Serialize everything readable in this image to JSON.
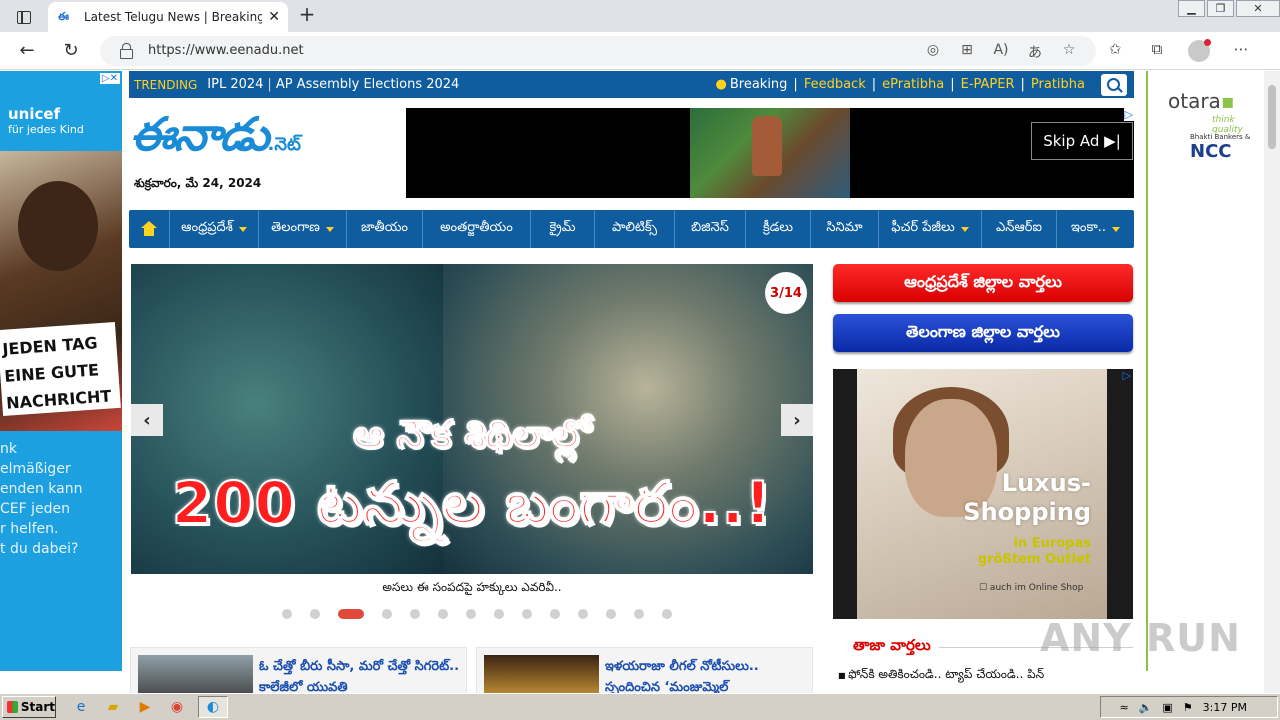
{
  "browser": {
    "tab_title": "Latest Telugu News | Breaking Ne",
    "tab_close": "✕",
    "new_tab": "+",
    "url": "https://www.eenadu.net",
    "back": "←",
    "reload": "↻"
  },
  "topstrip": {
    "trending_label": "TRENDING",
    "trending_items": [
      "IPL 2024",
      "AP Assembly Elections 2024"
    ],
    "breaking": "Breaking",
    "links": [
      "Feedback",
      "ePratibha",
      "E-PAPER",
      "Pratibha"
    ]
  },
  "masthead": {
    "logo_main": "ఈనాడు",
    "logo_suffix": ".నెట్",
    "date": "శుక్రవారం, మే 24, 2024"
  },
  "top_ad": {
    "skip_label": "Skip Ad ▶|"
  },
  "nav": {
    "items": [
      {
        "label": "ఆంధ్రప్రదేశ్",
        "dropdown": true
      },
      {
        "label": "తెలంగాణ",
        "dropdown": true
      },
      {
        "label": "జాతీయం",
        "dropdown": false
      },
      {
        "label": "అంతర్జాతీయం",
        "dropdown": false
      },
      {
        "label": "క్రైమ్",
        "dropdown": false
      },
      {
        "label": "పాలిటిక్స్",
        "dropdown": false
      },
      {
        "label": "బిజినెస్",
        "dropdown": false
      },
      {
        "label": "క్రీడలు",
        "dropdown": false
      },
      {
        "label": "సినిమా",
        "dropdown": false
      },
      {
        "label": "ఫీచర్ పేజీలు",
        "dropdown": true
      },
      {
        "label": "ఎన్‌ఆర్‌ఐ",
        "dropdown": false
      },
      {
        "label": "ఇంకా..",
        "dropdown": true
      }
    ]
  },
  "slider": {
    "headline_line1": "ఆ నౌక శిథిలాల్లో",
    "headline_line2": "200 టన్నుల బంగారం..!",
    "counter": "3/14",
    "prev": "‹",
    "next": "›",
    "caption": "అసలు ఈ సంపదపై హక్కులు ఎవరివీ..",
    "dot_count": 14,
    "active_dot": 3
  },
  "district_buttons": {
    "ap": "ఆంధ్రప్రదేశ్ జిల్లాల వార్తలు",
    "ts": "తెలంగాణ జిల్లాల వార్తలు"
  },
  "side_ad": {
    "title_line1": "Luxus-",
    "title_line2": "Shopping",
    "sub_line1": "in Europas",
    "sub_line2": "größtem Outlet",
    "note": "☐ auch im Online Shop"
  },
  "left_ad": {
    "brand": "unicef",
    "tagline": "für jedes Kind",
    "banner": [
      "JEDEN TAG",
      "EINE GUTE",
      "NACHRICHT"
    ],
    "blurb": [
      "nk",
      "elmäßiger",
      "enden kann",
      "CEF jeden",
      "r helfen.",
      "",
      "t du dabei?"
    ]
  },
  "right_ad": {
    "brand": "otara",
    "tagline": "think quality",
    "sub": "Bhakti Bankers &",
    "ncc": "NCC"
  },
  "latest": {
    "heading": "తాజా వార్తలు",
    "first_item": "ఫోన్‌కి అతికించండి.. ట్యాప్ చేయండి.. పిన్"
  },
  "cards": [
    {
      "text": "ఓ చేత్తో బీరు సీసా, మరో చేత్తో సిగరెట్.. కాలేజీలో యువతి"
    },
    {
      "text": "ఇళయరాజా లీగల్ నోటీసులు.. స్పందించిన ‘మంజుమ్మెల్"
    }
  ],
  "watermark": "ANY RUN",
  "taskbar": {
    "start": "Start",
    "time": "3:17 PM"
  }
}
